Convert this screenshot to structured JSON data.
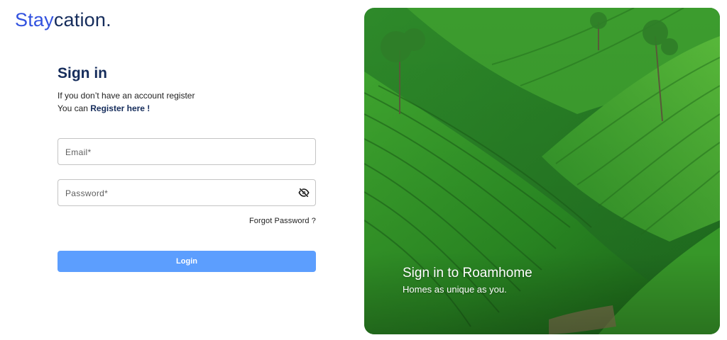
{
  "logo": {
    "part1": "Stay",
    "part2": "cation."
  },
  "signin": {
    "title": "Sign in",
    "line1": "If you don’t have an account register",
    "line2_prefix": "You can ",
    "register_link": "Register here !",
    "email_placeholder": "Email*",
    "password_placeholder": "Password*",
    "forgot_password": "Forgot Password ?",
    "login_label": "Login"
  },
  "hero": {
    "title": "Sign in to Roamhome",
    "subtitle": "Homes as unique as you.",
    "image": "tea-plantation-hills-photo"
  },
  "icons": {
    "password_toggle": "eye-off-icon"
  },
  "colors": {
    "brand_blue": "#3252df",
    "brand_navy": "#152c5b",
    "button_blue": "#5c9efe",
    "field_border": "#c4c4c4"
  }
}
